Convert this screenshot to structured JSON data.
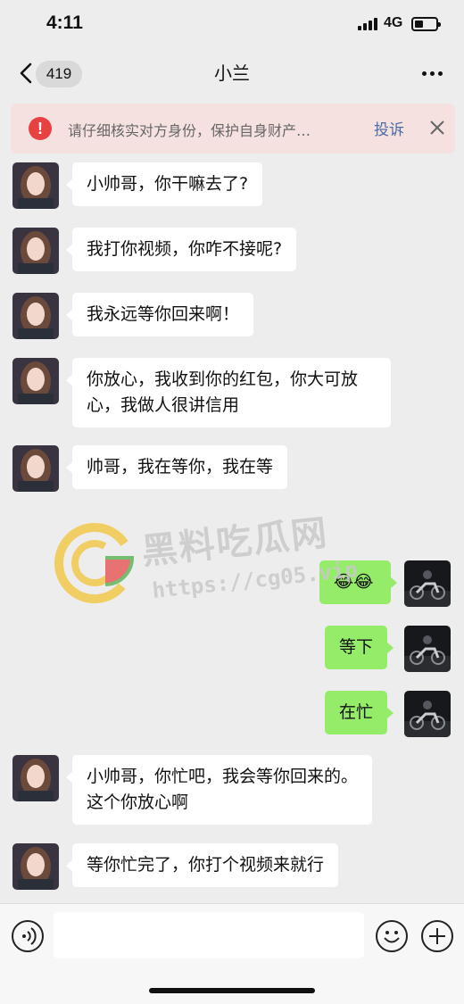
{
  "status_bar": {
    "time": "4:11",
    "network": "4G"
  },
  "nav": {
    "back_count": "419",
    "title": "小兰"
  },
  "banner": {
    "icon_glyph": "!",
    "text": "请仔细核实对方身份，保护自身财产…",
    "report_label": "投诉"
  },
  "messages": [
    {
      "side": "in",
      "text": "小帅哥，你干嘛去了?"
    },
    {
      "side": "in",
      "text": "我打你视频，你咋不接呢?"
    },
    {
      "side": "in",
      "text": "我永远等你回来啊！"
    },
    {
      "side": "in",
      "text": "你放心，我收到你的红包，你大可放心，我做人很讲信用"
    },
    {
      "side": "in",
      "text": "帅哥，我在等你，我在等"
    },
    {
      "side": "out",
      "text": "😂😂"
    },
    {
      "side": "out",
      "text": "等下"
    },
    {
      "side": "out",
      "text": "在忙"
    },
    {
      "side": "in",
      "text": "小帅哥，你忙吧，我会等你回来的。这个你放心啊"
    },
    {
      "side": "in",
      "text": "等你忙完了，你打个视频来就行"
    }
  ],
  "watermark": {
    "title": "黑料吃瓜网",
    "url": "https://cg05.vip"
  },
  "input_bar": {
    "value": ""
  },
  "colors": {
    "background": "#ededed",
    "outgoing_bubble": "#95ec69",
    "incoming_bubble": "#ffffff",
    "warning_red": "#e84141",
    "link_blue": "#4a6da4"
  }
}
